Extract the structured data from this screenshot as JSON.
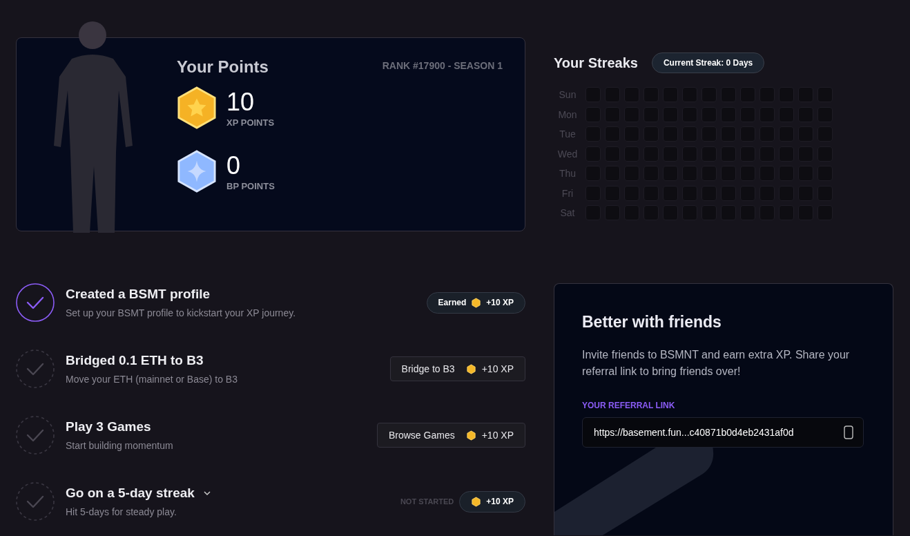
{
  "points": {
    "title": "Your Points",
    "rank": "RANK #17900 - SEASON 1",
    "stats": [
      {
        "kind": "xp",
        "value": "10",
        "label": "XP POINTS"
      },
      {
        "kind": "bp",
        "value": "0",
        "label": "BP POINTS"
      }
    ]
  },
  "streaks": {
    "title": "Your Streaks",
    "current": "Current Streak: 0 Days",
    "days": [
      {
        "label": "Sun",
        "cells": [
          {
            "active": false
          },
          {
            "active": false
          },
          {
            "active": false
          },
          {
            "active": false
          },
          {
            "active": false
          },
          {
            "active": false
          },
          {
            "active": false
          },
          {
            "active": false
          },
          {
            "active": false
          },
          {
            "active": false
          },
          {
            "active": false
          },
          {
            "active": false
          },
          {
            "active": false
          }
        ]
      },
      {
        "label": "Mon",
        "cells": [
          {
            "active": false
          },
          {
            "active": false
          },
          {
            "active": false
          },
          {
            "active": false
          },
          {
            "active": false
          },
          {
            "active": false
          },
          {
            "active": false
          },
          {
            "active": false
          },
          {
            "active": false
          },
          {
            "active": false
          },
          {
            "active": false
          },
          {
            "active": false
          },
          {
            "active": false
          }
        ]
      },
      {
        "label": "Tue",
        "cells": [
          {
            "active": false
          },
          {
            "active": false
          },
          {
            "active": false
          },
          {
            "active": false
          },
          {
            "active": false
          },
          {
            "active": false
          },
          {
            "active": false
          },
          {
            "active": false
          },
          {
            "active": false
          },
          {
            "active": false
          },
          {
            "active": false
          },
          {
            "active": false
          },
          {
            "active": false
          }
        ]
      },
      {
        "label": "Wed",
        "cells": [
          {
            "active": false
          },
          {
            "active": false
          },
          {
            "active": false
          },
          {
            "active": false
          },
          {
            "active": false
          },
          {
            "active": false
          },
          {
            "active": false
          },
          {
            "active": false
          },
          {
            "active": false
          },
          {
            "active": false
          },
          {
            "active": false
          },
          {
            "active": false
          },
          {
            "active": false
          }
        ]
      },
      {
        "label": "Thu",
        "cells": [
          {
            "active": false
          },
          {
            "active": false
          },
          {
            "active": false
          },
          {
            "active": false
          },
          {
            "active": false
          },
          {
            "active": false
          },
          {
            "active": false
          },
          {
            "active": false
          },
          {
            "active": false
          },
          {
            "active": false
          },
          {
            "active": false
          },
          {
            "active": false
          },
          {
            "active": false
          }
        ]
      },
      {
        "label": "Fri",
        "cells": [
          {
            "active": false
          },
          {
            "active": false
          },
          {
            "active": false
          },
          {
            "active": false
          },
          {
            "active": false
          },
          {
            "active": false
          },
          {
            "active": false
          },
          {
            "active": false
          },
          {
            "active": false
          },
          {
            "active": false
          },
          {
            "active": false
          },
          {
            "active": false
          },
          {
            "active": false
          }
        ]
      },
      {
        "label": "Sat",
        "cells": [
          {
            "active": false
          },
          {
            "active": false
          },
          {
            "active": false
          },
          {
            "active": false
          },
          {
            "active": false
          },
          {
            "active": false
          },
          {
            "active": false
          },
          {
            "active": false
          },
          {
            "active": false
          },
          {
            "active": false
          },
          {
            "active": false
          },
          {
            "active": false
          },
          {
            "active": false
          }
        ]
      }
    ]
  },
  "tasks": [
    {
      "kind": "earned",
      "completed": true,
      "title": "Created a BSMT profile",
      "description": "Set up your BSMT profile to kickstart your XP journey.",
      "status": "Earned",
      "reward": "+10 XP"
    },
    {
      "kind": "action",
      "completed": false,
      "title": "Bridged 0.1 ETH to B3",
      "description": "Move your ETH (mainnet or Base) to B3",
      "action": "Bridge to B3",
      "reward": "+10 XP"
    },
    {
      "kind": "action",
      "completed": false,
      "title": "Play 3 Games",
      "description": "Start building momentum",
      "action": "Browse Games",
      "reward": "+10 XP"
    },
    {
      "kind": "pending",
      "completed": false,
      "expanded": false,
      "title": "Go on a 5-day streak",
      "description": "Hit 5-days for steady play.",
      "status": "NOT STARTED",
      "reward": "+10 XP"
    }
  ],
  "referral": {
    "title": "Better with friends",
    "text": "Invite friends to BSMNT and earn extra XP. Share your referral link to bring friends over!",
    "label": "YOUR REFERRAL LINK",
    "link": "https://basement.fun...c40871b0d4eb2431af0d"
  }
}
